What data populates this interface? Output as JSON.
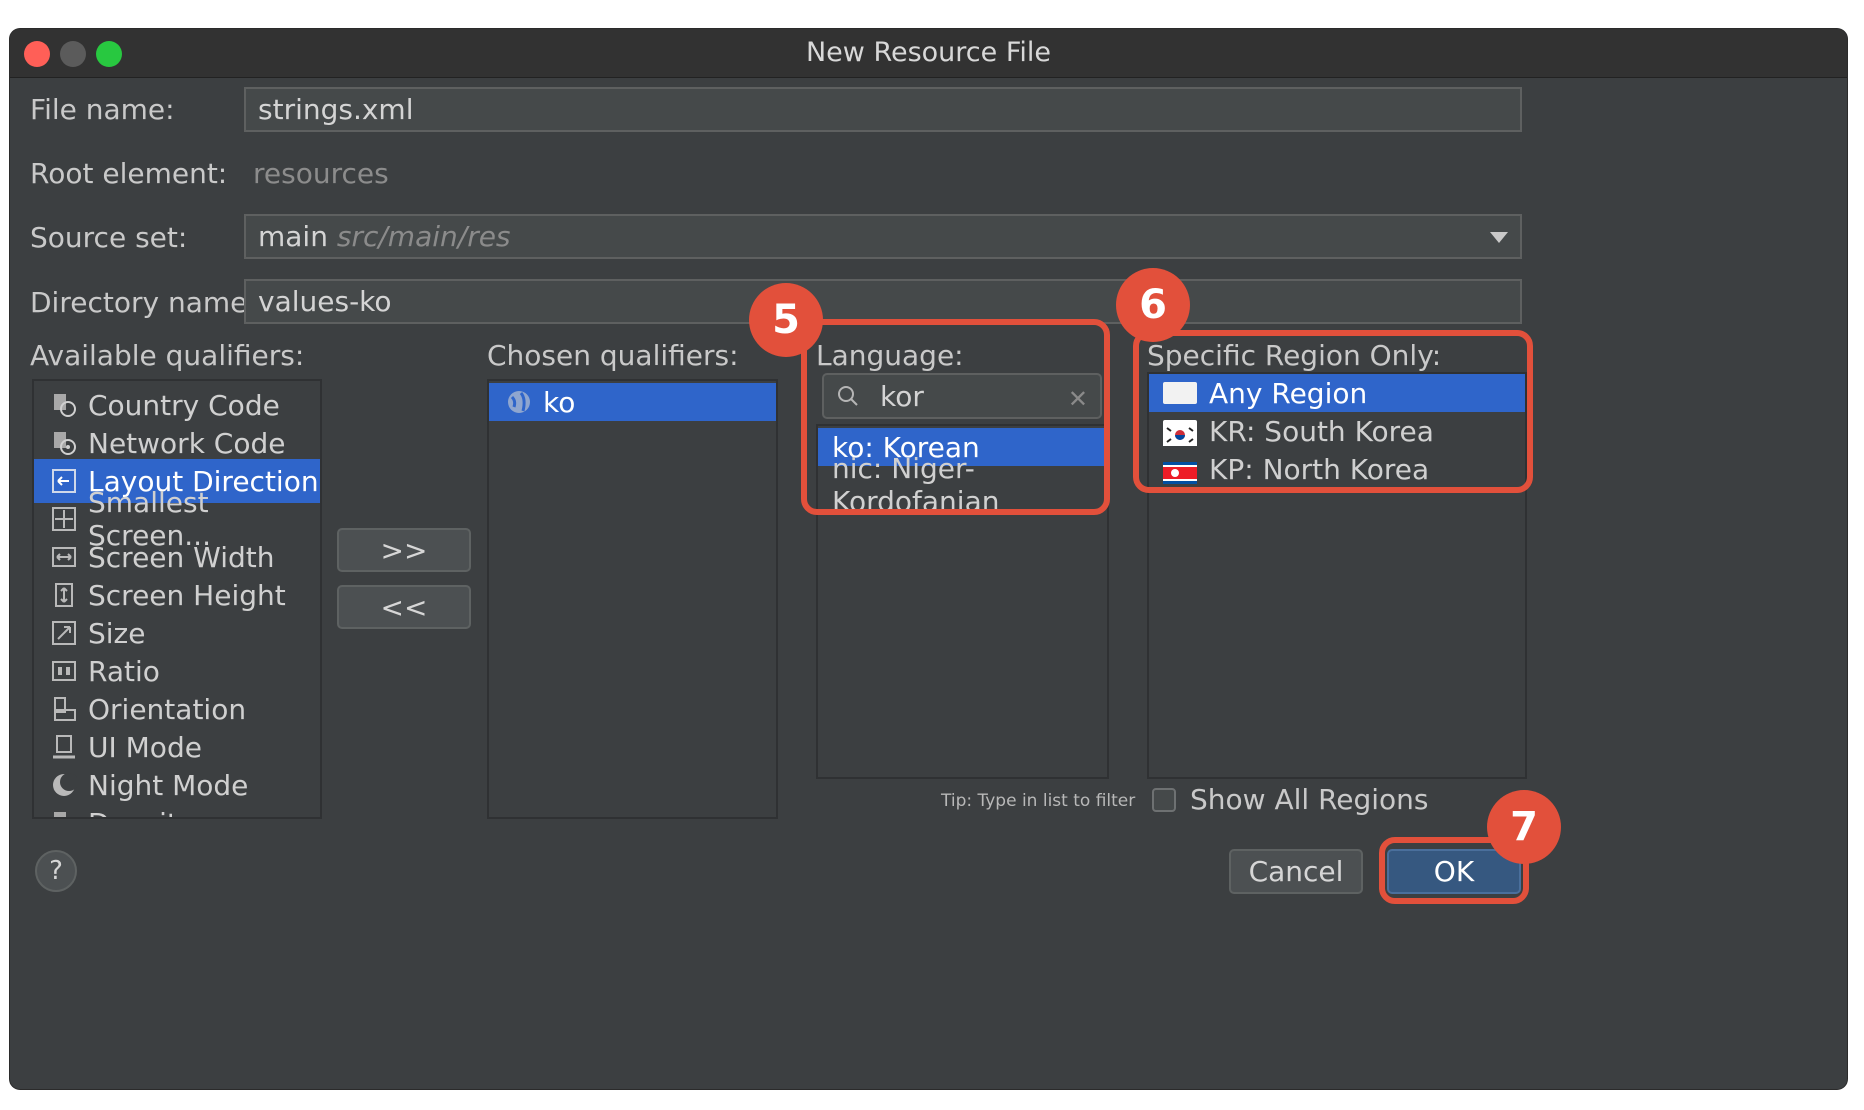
{
  "window": {
    "title": "New Resource File"
  },
  "form": {
    "file_name_label": "File name:",
    "file_name_value": "strings.xml",
    "root_element_label": "Root element:",
    "root_element_value": "resources",
    "source_set_label": "Source set:",
    "source_set_main": "main",
    "source_set_path": "src/main/res",
    "directory_name_label": "Directory name:",
    "directory_name_value": "values-ko"
  },
  "available": {
    "label": "Available qualifiers:",
    "items": [
      {
        "label": "Country Code",
        "icon": "country-code-icon"
      },
      {
        "label": "Network Code",
        "icon": "network-code-icon"
      },
      {
        "label": "Layout Direction",
        "icon": "layout-direction-icon",
        "selected": true
      },
      {
        "label": "Smallest Screen...",
        "icon": "smallest-screen-icon"
      },
      {
        "label": "Screen Width",
        "icon": "screen-width-icon"
      },
      {
        "label": "Screen Height",
        "icon": "screen-height-icon"
      },
      {
        "label": "Size",
        "icon": "size-icon"
      },
      {
        "label": "Ratio",
        "icon": "ratio-icon"
      },
      {
        "label": "Orientation",
        "icon": "orientation-icon"
      },
      {
        "label": "UI Mode",
        "icon": "ui-mode-icon"
      },
      {
        "label": "Night Mode",
        "icon": "night-mode-icon"
      },
      {
        "label": "Density",
        "icon": "density-icon"
      }
    ]
  },
  "move": {
    "add_label": ">>",
    "remove_label": "<<"
  },
  "chosen": {
    "label": "Chosen qualifiers:",
    "items": [
      {
        "label": "ko",
        "icon": "globe-icon",
        "selected": true
      }
    ]
  },
  "language": {
    "label": "Language:",
    "search_value": "kor",
    "items": [
      {
        "label": "ko: Korean",
        "selected": true
      },
      {
        "label": "nic: Niger-Kordofanian"
      }
    ],
    "tip": "Tip: Type in list to filter"
  },
  "region": {
    "label": "Specific Region Only:",
    "items": [
      {
        "label": "Any Region",
        "flag": "blank-flag-icon",
        "selected": true
      },
      {
        "label": "KR: South Korea",
        "flag": "south-korea-flag-icon"
      },
      {
        "label": "KP: North Korea",
        "flag": "north-korea-flag-icon"
      }
    ],
    "show_all_label": "Show All Regions"
  },
  "footer": {
    "help_label": "?",
    "cancel_label": "Cancel",
    "ok_label": "OK"
  },
  "callouts": {
    "step5": "5",
    "step6": "6",
    "step7": "7"
  },
  "colors": {
    "accent": "#2f65ca",
    "callout": "#e2503b",
    "panel": "#3c3f41"
  }
}
